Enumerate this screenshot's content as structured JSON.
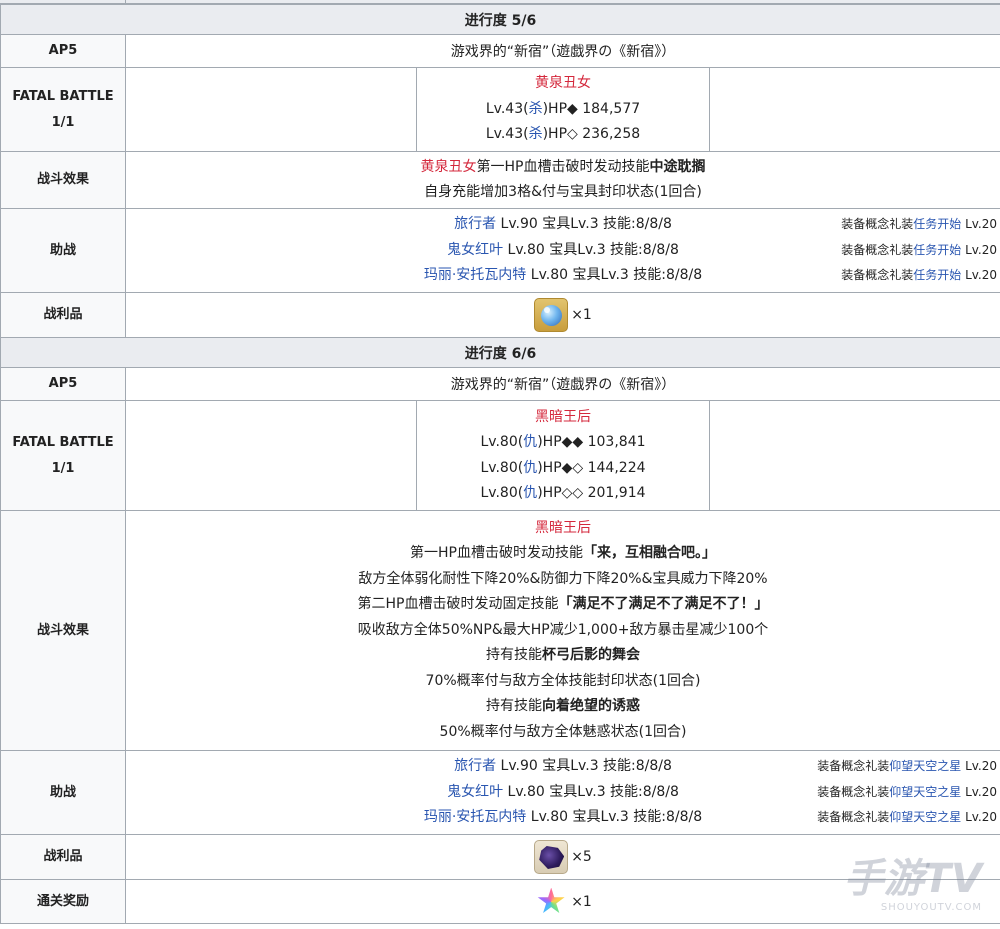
{
  "sections": [
    {
      "progress": "进行度 5/6",
      "ap_label": "AP5",
      "quest_name": "游戏界的“新宿”（遊戯界の《新宿》）",
      "battle_label_line1": "FATAL BATTLE",
      "battle_label_line2": "1/1",
      "enemy_name": "黄泉丑女",
      "enemy_lines": [
        {
          "lv": "Lv.43(",
          "cls": "杀",
          "rest": ")HP◆ 184,577"
        },
        {
          "lv": "Lv.43(",
          "cls": "杀",
          "rest": ")HP◇ 236,258"
        }
      ],
      "effect_label": "战斗效果",
      "effect_line1_name": "黄泉丑女",
      "effect_line1_mid": "第一HP血槽击破时发动技能",
      "effect_line1_skill": "中途耽搁",
      "effect_line2": "自身充能增加3格&付与宝具封印状态(1回合)",
      "support_label": "助战",
      "supports": [
        {
          "name": "旅行者",
          "stats": " Lv.90 宝具Lv.3 技能:8/8/8",
          "ce_prefix": "装备概念礼装",
          "ce_name": "任务开始",
          "ce_lv": " Lv.20"
        },
        {
          "name": "鬼女红叶",
          "stats": " Lv.80 宝具Lv.3 技能:8/8/8",
          "ce_prefix": "装备概念礼装",
          "ce_name": "任务开始",
          "ce_lv": " Lv.20"
        },
        {
          "name": "玛丽·安托瓦内特",
          "stats": " Lv.80 宝具Lv.3 技能:8/8/8",
          "ce_prefix": "装备概念礼装",
          "ce_name": "任务开始",
          "ce_lv": " Lv.20"
        }
      ],
      "drop_label": "战利品",
      "drop_icon": "blue-gem-icon",
      "drop_count": "×1"
    },
    {
      "progress": "进行度 6/6",
      "ap_label": "AP5",
      "quest_name": "游戏界的“新宿”（遊戯界の《新宿》）",
      "battle_label_line1": "FATAL BATTLE",
      "battle_label_line2": "1/1",
      "enemy_name": "黑暗王后",
      "enemy_lines": [
        {
          "lv": "Lv.80(",
          "cls": "仇",
          "rest": ")HP◆◆ 103,841"
        },
        {
          "lv": "Lv.80(",
          "cls": "仇",
          "rest": ")HP◆◇ 144,224"
        },
        {
          "lv": "Lv.80(",
          "cls": "仇",
          "rest": ")HP◇◇ 201,914"
        }
      ],
      "effect_label": "战斗效果",
      "effect_name": "黑暗王后",
      "effect_l1_text": "第一HP血槽击破时发动技能",
      "effect_l1_skill": "「来，互相融合吧。」",
      "effect_l2": "敌方全体弱化耐性下降20%&防御力下降20%&宝具威力下降20%",
      "effect_l3_text": "第二HP血槽击破时发动固定技能",
      "effect_l3_skill": "「满足不了满足不了满足不了！」",
      "effect_l4": "吸收敌方全体50%NP&最大HP减少1,000+敌方暴击星减少100个",
      "effect_l5_text": "持有技能",
      "effect_l5_skill": "杯弓后影的舞会",
      "effect_l6": "70%概率付与敌方全体技能封印状态(1回合)",
      "effect_l7_text": "持有技能",
      "effect_l7_skill": "向着绝望的诱惑",
      "effect_l8": "50%概率付与敌方全体魅惑状态(1回合)",
      "support_label": "助战",
      "supports": [
        {
          "name": "旅行者",
          "stats": " Lv.90 宝具Lv.3 技能:8/8/8",
          "ce_prefix": "装备概念礼装",
          "ce_name": "仰望天空之星",
          "ce_lv": " Lv.20"
        },
        {
          "name": "鬼女红叶",
          "stats": " Lv.80 宝具Lv.3 技能:8/8/8",
          "ce_prefix": "装备概念礼装",
          "ce_name": "仰望天空之星",
          "ce_lv": " Lv.20"
        },
        {
          "name": "玛丽·安托瓦内特",
          "stats": " Lv.80 宝具Lv.3 技能:8/8/8",
          "ce_prefix": "装备概念礼装",
          "ce_name": "仰望天空之星",
          "ce_lv": " Lv.20"
        }
      ],
      "drop_label": "战利品",
      "drop_icon": "dark-crystal-icon",
      "drop_count": "×5",
      "reward_label": "通关奖励",
      "reward_icon": "saint-quartz-icon",
      "reward_count": "×1"
    }
  ],
  "watermark": {
    "main": "手游TV",
    "sub": "SHOUYOUTV.COM"
  }
}
